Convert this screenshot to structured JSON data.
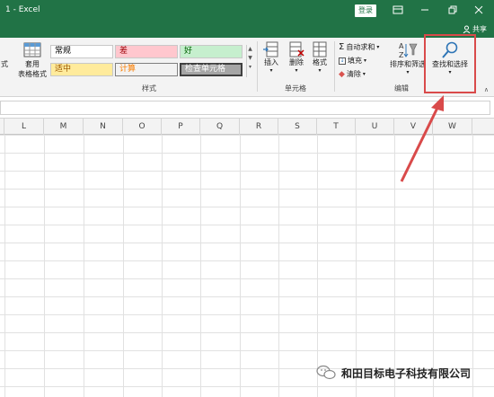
{
  "titlebar": {
    "title": "1 - Excel",
    "login": "登录"
  },
  "sharebar": {
    "share_label": "共享"
  },
  "ribbon": {
    "left_cut_label": "式",
    "format_table": {
      "line1": "套用",
      "line2": "表格格式"
    },
    "styles": {
      "normal": "常规",
      "bad": "差",
      "good": "好",
      "neutral": "适中",
      "calc": "计算",
      "check": "检查单元格"
    },
    "styles_group": "样式",
    "cells": {
      "insert": "插入",
      "delete": "删除",
      "format": "格式"
    },
    "cells_group": "单元格",
    "editing": {
      "autosum": "自动求和",
      "fill": "填充",
      "clear": "清除",
      "sort_filter": "排序和筛选",
      "find_select": "查找和选择"
    },
    "editing_group": "编辑"
  },
  "columns": [
    "L",
    "M",
    "N",
    "O",
    "P",
    "Q",
    "R",
    "S",
    "T",
    "U",
    "V",
    "W"
  ],
  "watermark": "和田目标电子科技有限公司",
  "colors": {
    "excel_green": "#217346",
    "bad_fill": "#ffc7ce",
    "bad_text": "#9c0006",
    "good_fill": "#c6efce",
    "good_text": "#006100",
    "neutral_fill": "#ffeb9c",
    "neutral_text": "#9c5700",
    "highlight": "#d94a4a"
  }
}
